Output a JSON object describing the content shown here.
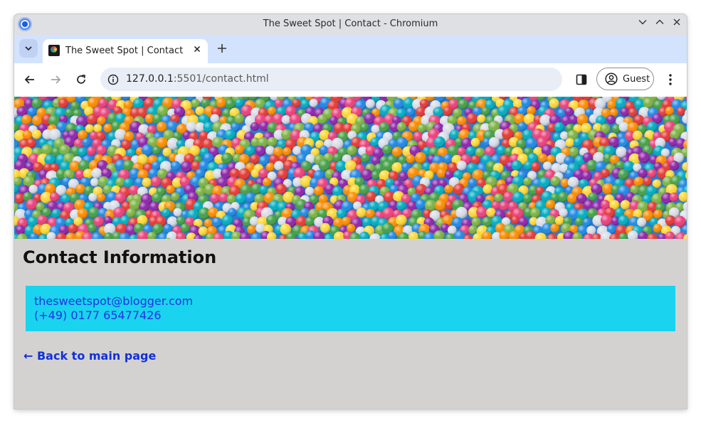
{
  "window": {
    "title": "The Sweet Spot | Contact - Chromium"
  },
  "tabs": [
    {
      "title": "The Sweet Spot | Contact",
      "active": true
    }
  ],
  "toolbar": {
    "url_host": "127.0.0.1",
    "url_path": ":5501/contact.html",
    "profile_label": "Guest"
  },
  "page": {
    "heading": "Contact Information",
    "contact": {
      "email": "thesweetspot@blogger.com",
      "phone": "(+49) 0177 65477426"
    },
    "back_link": "← Back to main page",
    "hero_colors": [
      "#e53935",
      "#fdd835",
      "#43a047",
      "#1e88e5",
      "#8e24aa",
      "#fb8c00",
      "#00acc1",
      "#ec407a",
      "#d8dde8",
      "#7cb342"
    ]
  },
  "colors": {
    "page_background": "#d3d2d1",
    "contact_box": "#1ad3ee",
    "link": "#1230d8"
  }
}
